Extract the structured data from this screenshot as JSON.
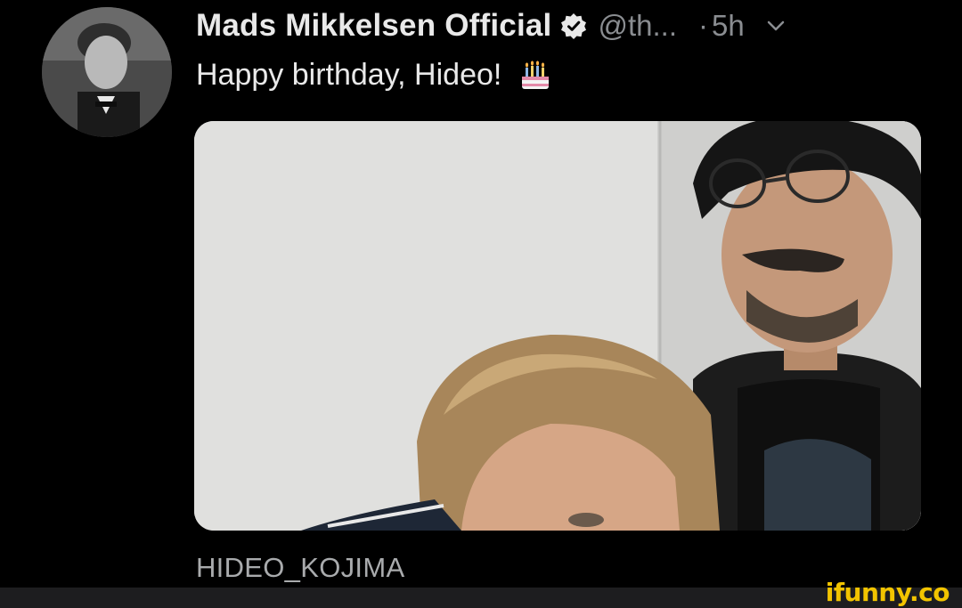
{
  "tweet": {
    "display_name": "Mads Mikkelsen Official",
    "handle": "@th...",
    "separator": "·",
    "time": "5h",
    "text": "Happy birthday, Hideo!",
    "tag": "HIDEO_KOJIMA"
  },
  "icons": {
    "verified": "verified-badge-icon",
    "chevron": "chevron-down-icon",
    "emoji": "birthday-cake-emoji"
  },
  "colors": {
    "background": "#000000",
    "primary_text": "#e9e9e9",
    "secondary_text": "#8a8d91",
    "watermark": "#f2c400"
  },
  "watermark": {
    "text": "ifunny.co"
  }
}
